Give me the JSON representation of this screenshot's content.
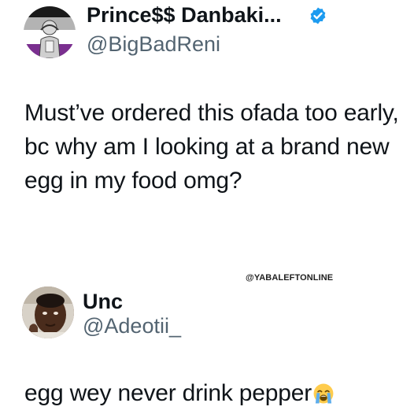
{
  "tweets": [
    {
      "display_name": "Prince$$ Danbaki...",
      "handle": "@BigBadReni",
      "verified": true,
      "avatar_icon": "profile-photo",
      "text": "Must’ve ordered this ofada too early, bc why am I looking at a brand new egg in my food omg?"
    },
    {
      "display_name": "Unc",
      "handle": "@Adeotii_",
      "verified": false,
      "avatar_icon": "profile-photo",
      "text": "egg wey never drink pepper",
      "emoji": "loudly-crying-face-icon"
    }
  ],
  "watermark": "@YABALEFTONLINE",
  "colors": {
    "text": "#0f1419",
    "secondary": "#536471",
    "verified": "#1d9bf0",
    "background": "#ffffff"
  }
}
